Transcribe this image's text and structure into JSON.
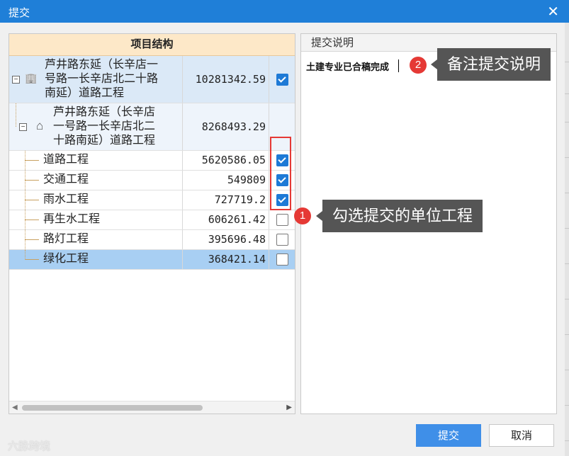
{
  "window": {
    "title": "提交",
    "close_glyph": "✕"
  },
  "tree": {
    "header": "项目结构",
    "rows": [
      {
        "lines": [
          "芦井路东延（长辛店一",
          "号路一长辛店北二十路",
          "南延）道路工程"
        ],
        "amount": "10281342.59",
        "checked": true,
        "level": 0,
        "icon": "building-icon"
      },
      {
        "lines": [
          "芦井路东延（长辛店",
          "一号路一长辛店北二",
          "十路南延）道路工程"
        ],
        "amount": "8268493.29",
        "checked": null,
        "level": 1,
        "icon": "house-icon"
      },
      {
        "lines": [
          "道路工程"
        ],
        "amount": "5620586.05",
        "checked": true,
        "level": 2
      },
      {
        "lines": [
          "交通工程"
        ],
        "amount": "549809",
        "checked": true,
        "level": 2
      },
      {
        "lines": [
          "雨水工程"
        ],
        "amount": "727719.2",
        "checked": true,
        "level": 2
      },
      {
        "lines": [
          "再生水工程"
        ],
        "amount": "606261.42",
        "checked": false,
        "level": 2
      },
      {
        "lines": [
          "路灯工程"
        ],
        "amount": "395696.48",
        "checked": false,
        "level": 2
      },
      {
        "lines": [
          "绿化工程"
        ],
        "amount": "368421.14",
        "checked": false,
        "level": 2,
        "selected": true
      }
    ]
  },
  "description": {
    "header": "提交说明",
    "value": "土建专业已合稿完成"
  },
  "annotations": [
    {
      "number": "1",
      "text": "勾选提交的单位工程"
    },
    {
      "number": "2",
      "text": "备注提交说明"
    }
  ],
  "buttons": {
    "submit": "提交",
    "cancel": "取消"
  },
  "watermark": "六脉跨境",
  "colors": {
    "titlebar": "#1f7fd8",
    "header_bg": "#fde8c8",
    "selected_row": "#a8cff3",
    "parent_row": "#dbe9f7",
    "checkbox": "#1e7ad6",
    "marker": "#e53935",
    "callout": "#555555"
  }
}
